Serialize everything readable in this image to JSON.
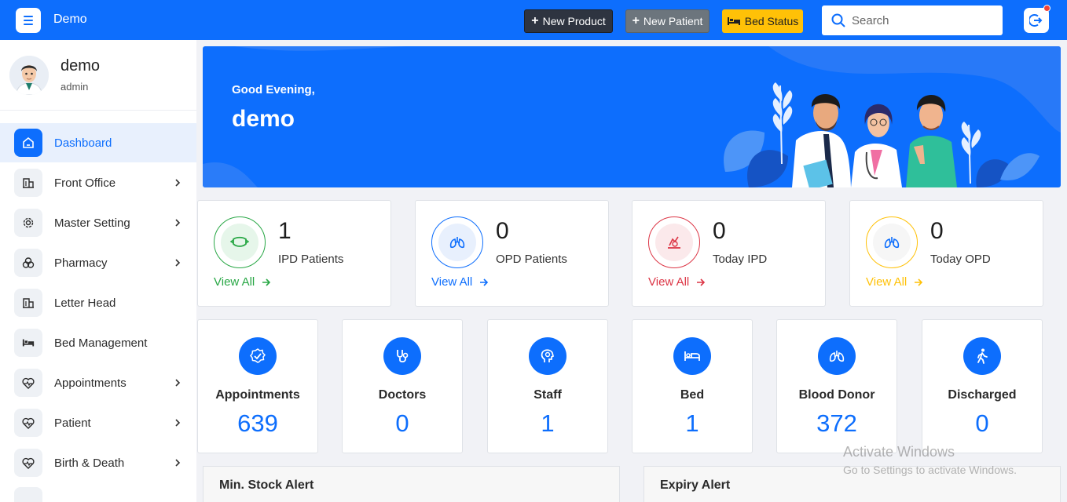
{
  "topbar": {
    "brand": "Demo",
    "new_product": "New Product",
    "new_patient": "New Patient",
    "bed_status": "Bed Status",
    "search_placeholder": "Search"
  },
  "user": {
    "name": "demo",
    "role": "admin"
  },
  "sidebar": {
    "items": [
      {
        "label": "Dashboard",
        "icon": "home-icon",
        "active": true,
        "chevron": false
      },
      {
        "label": "Front Office",
        "icon": "building-icon",
        "chevron": true
      },
      {
        "label": "Master Setting",
        "icon": "gear-icon",
        "chevron": true
      },
      {
        "label": "Pharmacy",
        "icon": "pharmacy-icon",
        "chevron": true
      },
      {
        "label": "Letter Head",
        "icon": "building-icon",
        "chevron": false
      },
      {
        "label": "Bed Management",
        "icon": "bed-icon",
        "chevron": false
      },
      {
        "label": "Appointments",
        "icon": "heartbeat-icon",
        "chevron": true
      },
      {
        "label": "Patient",
        "icon": "heartbeat-icon",
        "chevron": true
      },
      {
        "label": "Birth & Death",
        "icon": "heartbeat-icon",
        "chevron": true
      }
    ]
  },
  "banner": {
    "greeting": "Good Evening,",
    "name": "demo"
  },
  "stats": [
    {
      "value": "1",
      "label": "IPD Patients",
      "link": "View All",
      "color": "#28a745",
      "icon": "mask-icon"
    },
    {
      "value": "0",
      "label": "OPD Patients",
      "link": "View All",
      "color": "#0d6efd",
      "icon": "lungs-icon"
    },
    {
      "value": "0",
      "label": "Today IPD",
      "link": "View All",
      "color": "#dc3545",
      "icon": "medical-report-icon"
    },
    {
      "value": "0",
      "label": "Today OPD",
      "link": "View All",
      "color": "#ffc107",
      "icon": "lungs-icon"
    }
  ],
  "counts": [
    {
      "label": "Appointments",
      "value": "639",
      "icon": "check-badge-icon"
    },
    {
      "label": "Doctors",
      "value": "0",
      "icon": "stethoscope-icon"
    },
    {
      "label": "Staff",
      "value": "1",
      "icon": "head-icon"
    },
    {
      "label": "Bed",
      "value": "1",
      "icon": "bed-icon"
    },
    {
      "label": "Blood Donor",
      "value": "372",
      "icon": "lungs-icon"
    },
    {
      "label": "Discharged",
      "value": "0",
      "icon": "walking-icon"
    }
  ],
  "panels": {
    "min_stock": "Min. Stock Alert",
    "expiry": "Expiry Alert"
  },
  "watermark": {
    "line1": "Activate Windows",
    "line2": "Go to Settings to activate Windows."
  },
  "colors": {
    "primary": "#0d6efd",
    "warning": "#ffc107",
    "dark": "#2e3440",
    "secondary": "#6c757d"
  }
}
